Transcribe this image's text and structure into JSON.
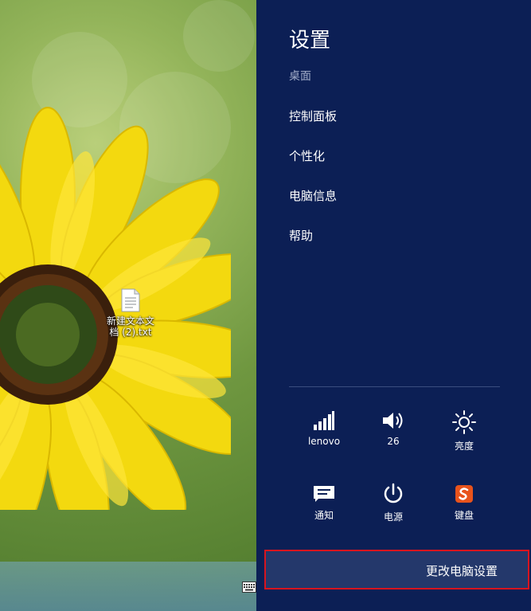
{
  "desktop": {
    "file": {
      "label": "新建文本文\n档 (2).txt",
      "icon": "text-file-icon"
    },
    "tray_icon": "keyboard-icon"
  },
  "settings_panel": {
    "title": "设置",
    "section_label": "桌面",
    "menu_items": [
      {
        "label": "控制面板"
      },
      {
        "label": "个性化"
      },
      {
        "label": "电脑信息"
      },
      {
        "label": "帮助"
      }
    ],
    "tiles": [
      {
        "label": "lenovo",
        "icon": "wifi-signal-icon"
      },
      {
        "label": "26",
        "icon": "volume-icon"
      },
      {
        "label": "亮度",
        "icon": "brightness-icon"
      },
      {
        "label": "通知",
        "icon": "notification-icon"
      },
      {
        "label": "电源",
        "icon": "power-icon"
      },
      {
        "label": "键盘",
        "icon": "sogou-ime-icon"
      }
    ],
    "change_settings_label": "更改电脑设置"
  },
  "colors": {
    "panel_bg": "#0c1f55",
    "highlight_border": "#d8141e",
    "button_bg": "#24386b"
  }
}
